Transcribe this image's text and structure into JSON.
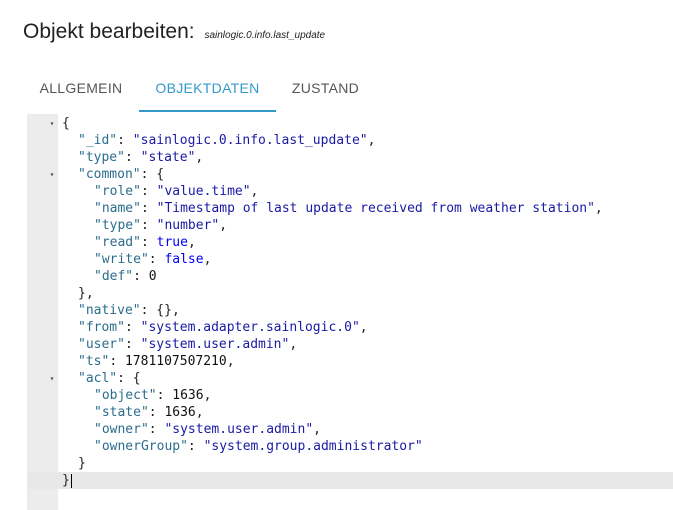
{
  "dialog": {
    "title": "Objekt bearbeiten:",
    "object_id": "sainlogic.0.info.last_update"
  },
  "tabs": [
    {
      "label": "ALLGEMEIN",
      "active": false
    },
    {
      "label": "OBJEKTDATEN",
      "active": true
    },
    {
      "label": "ZUSTAND",
      "active": false
    }
  ],
  "editor": {
    "fold_icon": "caret-down-icon",
    "lines": [
      {
        "indent": 0,
        "fold": true,
        "open": "{"
      },
      {
        "indent": 1,
        "key": "_id",
        "str": "sainlogic.0.info.last_update",
        "comma": true
      },
      {
        "indent": 1,
        "key": "type",
        "str": "state",
        "comma": true
      },
      {
        "indent": 1,
        "fold": true,
        "key": "common",
        "open": "{"
      },
      {
        "indent": 2,
        "key": "role",
        "str": "value.time",
        "comma": true
      },
      {
        "indent": 2,
        "key": "name",
        "str": "Timestamp of last update received from weather station",
        "comma": true
      },
      {
        "indent": 2,
        "key": "type",
        "str": "number",
        "comma": true
      },
      {
        "indent": 2,
        "key": "read",
        "bool": "true",
        "comma": true
      },
      {
        "indent": 2,
        "key": "write",
        "bool": "false",
        "comma": true
      },
      {
        "indent": 2,
        "key": "def",
        "num": "0"
      },
      {
        "indent": 1,
        "close": "}",
        "comma": true
      },
      {
        "indent": 1,
        "key": "native",
        "raw": "{}",
        "comma": true
      },
      {
        "indent": 1,
        "key": "from",
        "str": "system.adapter.sainlogic.0",
        "comma": true
      },
      {
        "indent": 1,
        "key": "user",
        "str": "system.user.admin",
        "comma": true
      },
      {
        "indent": 1,
        "key": "ts",
        "num": "1781107507210",
        "comma": true
      },
      {
        "indent": 1,
        "fold": true,
        "key": "acl",
        "open": "{"
      },
      {
        "indent": 2,
        "key": "object",
        "num": "1636",
        "comma": true
      },
      {
        "indent": 2,
        "key": "state",
        "num": "1636",
        "comma": true
      },
      {
        "indent": 2,
        "key": "owner",
        "str": "system.user.admin",
        "comma": true
      },
      {
        "indent": 2,
        "key": "ownerGroup",
        "str": "system.group.administrator"
      },
      {
        "indent": 1,
        "close": "}"
      },
      {
        "indent": 0,
        "close": "}",
        "current": true
      }
    ]
  }
}
